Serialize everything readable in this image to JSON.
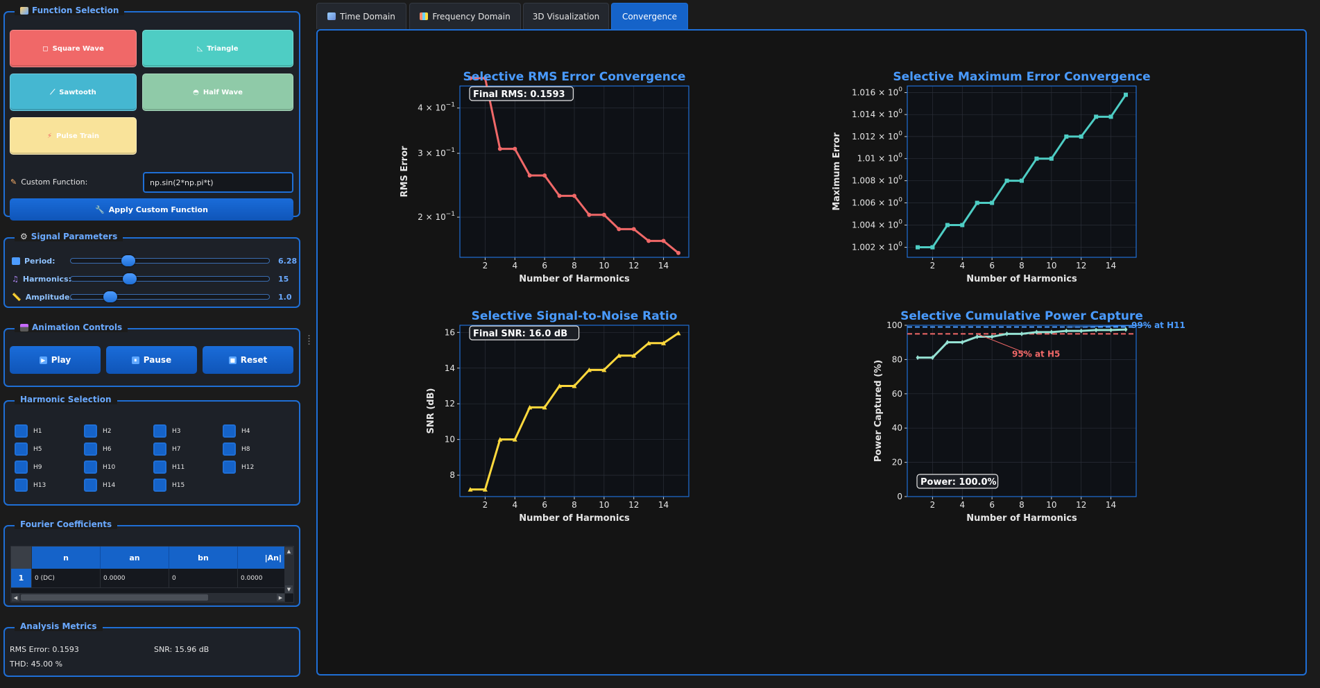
{
  "function_selection": {
    "title": "Function Selection",
    "buttons": [
      {
        "label": "Square Wave",
        "icon": "square-wave-icon",
        "color": "#f06868"
      },
      {
        "label": "Triangle",
        "icon": "triangle-icon",
        "color": "#4ecdc4"
      },
      {
        "label": "Sawtooth",
        "icon": "sawtooth-icon",
        "color": "#45b7d1"
      },
      {
        "label": "Half Wave",
        "icon": "half-wave-icon",
        "color": "#8fcaa8"
      },
      {
        "label": "Pulse Train",
        "icon": "pulse-train-icon",
        "color": "#f9e39a"
      }
    ],
    "custom_label": "Custom Function:",
    "custom_value": "np.sin(2*np.pi*t)",
    "apply_label": "Apply Custom Function"
  },
  "signal_parameters": {
    "title": "Signal Parameters",
    "period": {
      "label": "Period:",
      "value": "6.28",
      "fraction": 0.28
    },
    "harmonics": {
      "label": "Harmonics:",
      "value": "15",
      "fraction": 0.29
    },
    "amplitude": {
      "label": "Amplitude:",
      "value": "1.0",
      "fraction": 0.2
    }
  },
  "animation_controls": {
    "title": "Animation Controls",
    "play": "Play",
    "pause": "Pause",
    "reset": "Reset"
  },
  "harmonic_selection": {
    "title": "Harmonic Selection",
    "items": [
      "H1",
      "H2",
      "H3",
      "H4",
      "H5",
      "H6",
      "H7",
      "H8",
      "H9",
      "H10",
      "H11",
      "H12",
      "H13",
      "H14",
      "H15"
    ]
  },
  "fourier_coefficients": {
    "title": "Fourier Coefficients",
    "columns": [
      "n",
      "an",
      "bn",
      "|An|"
    ],
    "rows": [
      {
        "index": "1",
        "cells": [
          "0 (DC)",
          "0.0000",
          "0",
          "0.0000"
        ]
      }
    ]
  },
  "analysis_metrics": {
    "title": "Analysis Metrics",
    "rms": "RMS Error: 0.1593",
    "snr": "SNR: 15.96 dB",
    "thd": "THD: 45.00 %"
  },
  "tabs": [
    {
      "label": "Time Domain",
      "active": false
    },
    {
      "label": "Frequency Domain",
      "active": false
    },
    {
      "label": "3D Visualization",
      "active": false
    },
    {
      "label": "Convergence",
      "active": true
    }
  ],
  "chart_data": [
    {
      "type": "line",
      "title": "Selective RMS Error Convergence",
      "xlabel": "Number of Harmonics",
      "ylabel": "RMS Error",
      "yscale": "log",
      "color": "#f06868",
      "marker": "circle",
      "x": [
        1,
        2,
        3,
        4,
        5,
        6,
        7,
        8,
        9,
        10,
        11,
        12,
        13,
        14,
        15
      ],
      "y": [
        0.4834,
        0.4834,
        0.3086,
        0.3086,
        0.2606,
        0.2606,
        0.229,
        0.229,
        0.203,
        0.203,
        0.1854,
        0.1854,
        0.172,
        0.172,
        0.1593
      ],
      "xlim": [
        0.3,
        15.7
      ],
      "ylim": [
        0.155,
        0.46
      ],
      "xticks": [
        2,
        4,
        6,
        8,
        10,
        12,
        14
      ],
      "yticks": [
        {
          "v": 0.2,
          "base": "2",
          "exp": "−1"
        },
        {
          "v": 0.3,
          "base": "3",
          "exp": "−1"
        },
        {
          "v": 0.4,
          "base": "4",
          "exp": "−1"
        }
      ],
      "annotation": "Final RMS: 0.1593",
      "annotation_corner": "top-left",
      "grid": true
    },
    {
      "type": "line",
      "title": "Selective Maximum Error Convergence",
      "xlabel": "Number of Harmonics",
      "ylabel": "Maximum Error",
      "yscale": "log",
      "color": "#4ecdc4",
      "marker": "square",
      "x": [
        1,
        2,
        3,
        4,
        5,
        6,
        7,
        8,
        9,
        10,
        11,
        12,
        13,
        14,
        15
      ],
      "y": [
        1.002,
        1.002,
        1.004,
        1.004,
        1.006,
        1.006,
        1.008,
        1.008,
        1.01,
        1.01,
        1.012,
        1.012,
        1.0138,
        1.0138,
        1.0158
      ],
      "xlim": [
        0.3,
        15.7
      ],
      "ylim": [
        1.0011,
        1.0166
      ],
      "xticks": [
        2,
        4,
        6,
        8,
        10,
        12,
        14
      ],
      "yticks": [
        {
          "v": 1.002,
          "base": "1.002",
          "exp": "0"
        },
        {
          "v": 1.004,
          "base": "1.004",
          "exp": "0"
        },
        {
          "v": 1.006,
          "base": "1.006",
          "exp": "0"
        },
        {
          "v": 1.008,
          "base": "1.008",
          "exp": "0"
        },
        {
          "v": 1.01,
          "base": "1.01",
          "exp": "0"
        },
        {
          "v": 1.012,
          "base": "1.012",
          "exp": "0"
        },
        {
          "v": 1.014,
          "base": "1.014",
          "exp": "0"
        },
        {
          "v": 1.016,
          "base": "1.016",
          "exp": "0"
        }
      ],
      "grid": true
    },
    {
      "type": "line",
      "title": "Selective Signal-to-Noise Ratio",
      "xlabel": "Number of Harmonics",
      "ylabel": "SNR (dB)",
      "yscale": "linear",
      "color": "#ffd93d",
      "marker": "triangle",
      "x": [
        1,
        2,
        3,
        4,
        5,
        6,
        7,
        8,
        9,
        10,
        11,
        12,
        13,
        14,
        15
      ],
      "y": [
        7.2,
        7.2,
        10.0,
        10.0,
        11.8,
        11.8,
        13.0,
        13.0,
        13.9,
        13.9,
        14.7,
        14.7,
        15.4,
        15.4,
        15.96
      ],
      "xlim": [
        0.3,
        15.7
      ],
      "ylim": [
        6.8,
        16.4
      ],
      "xticks": [
        2,
        4,
        6,
        8,
        10,
        12,
        14
      ],
      "yticks": [
        {
          "v": 8,
          "base": "8"
        },
        {
          "v": 10,
          "base": "10"
        },
        {
          "v": 12,
          "base": "12"
        },
        {
          "v": 14,
          "base": "14"
        },
        {
          "v": 16,
          "base": "16"
        }
      ],
      "annotation": "Final SNR: 16.0 dB",
      "annotation_corner": "top-left",
      "grid": true
    },
    {
      "type": "line",
      "title": "Selective Cumulative Power Capture",
      "xlabel": "Number of Harmonics",
      "ylabel": "Power Captured (%)",
      "yscale": "linear",
      "color": "#95e1d3",
      "marker": "diamond",
      "x": [
        1,
        2,
        3,
        4,
        5,
        6,
        7,
        8,
        9,
        10,
        11,
        12,
        13,
        14,
        15
      ],
      "y": [
        81.1,
        81.1,
        90.1,
        90.1,
        93.3,
        93.3,
        95.0,
        95.0,
        96.0,
        96.0,
        96.7,
        96.7,
        97.2,
        97.2,
        97.5
      ],
      "xlim": [
        0.3,
        15.7
      ],
      "ylim": [
        0,
        100
      ],
      "xticks": [
        2,
        4,
        6,
        8,
        10,
        12,
        14
      ],
      "yticks": [
        {
          "v": 0,
          "base": "0"
        },
        {
          "v": 20,
          "base": "20"
        },
        {
          "v": 40,
          "base": "40"
        },
        {
          "v": 60,
          "base": "60"
        },
        {
          "v": 80,
          "base": "80"
        },
        {
          "v": 100,
          "base": "100"
        }
      ],
      "annotation": "Power: 100.0%",
      "annotation_corner": "bottom-left",
      "hlines": [
        {
          "y": 99,
          "color": "#4a9bff"
        },
        {
          "y": 95,
          "color": "#f06868"
        }
      ],
      "callouts": [
        {
          "text": "95% at H5",
          "x": 5,
          "y": 95,
          "color": "#f06868"
        },
        {
          "text": "99% at H11",
          "x": 11,
          "y": 99,
          "color": "#4a9bff"
        }
      ],
      "grid": true
    }
  ]
}
